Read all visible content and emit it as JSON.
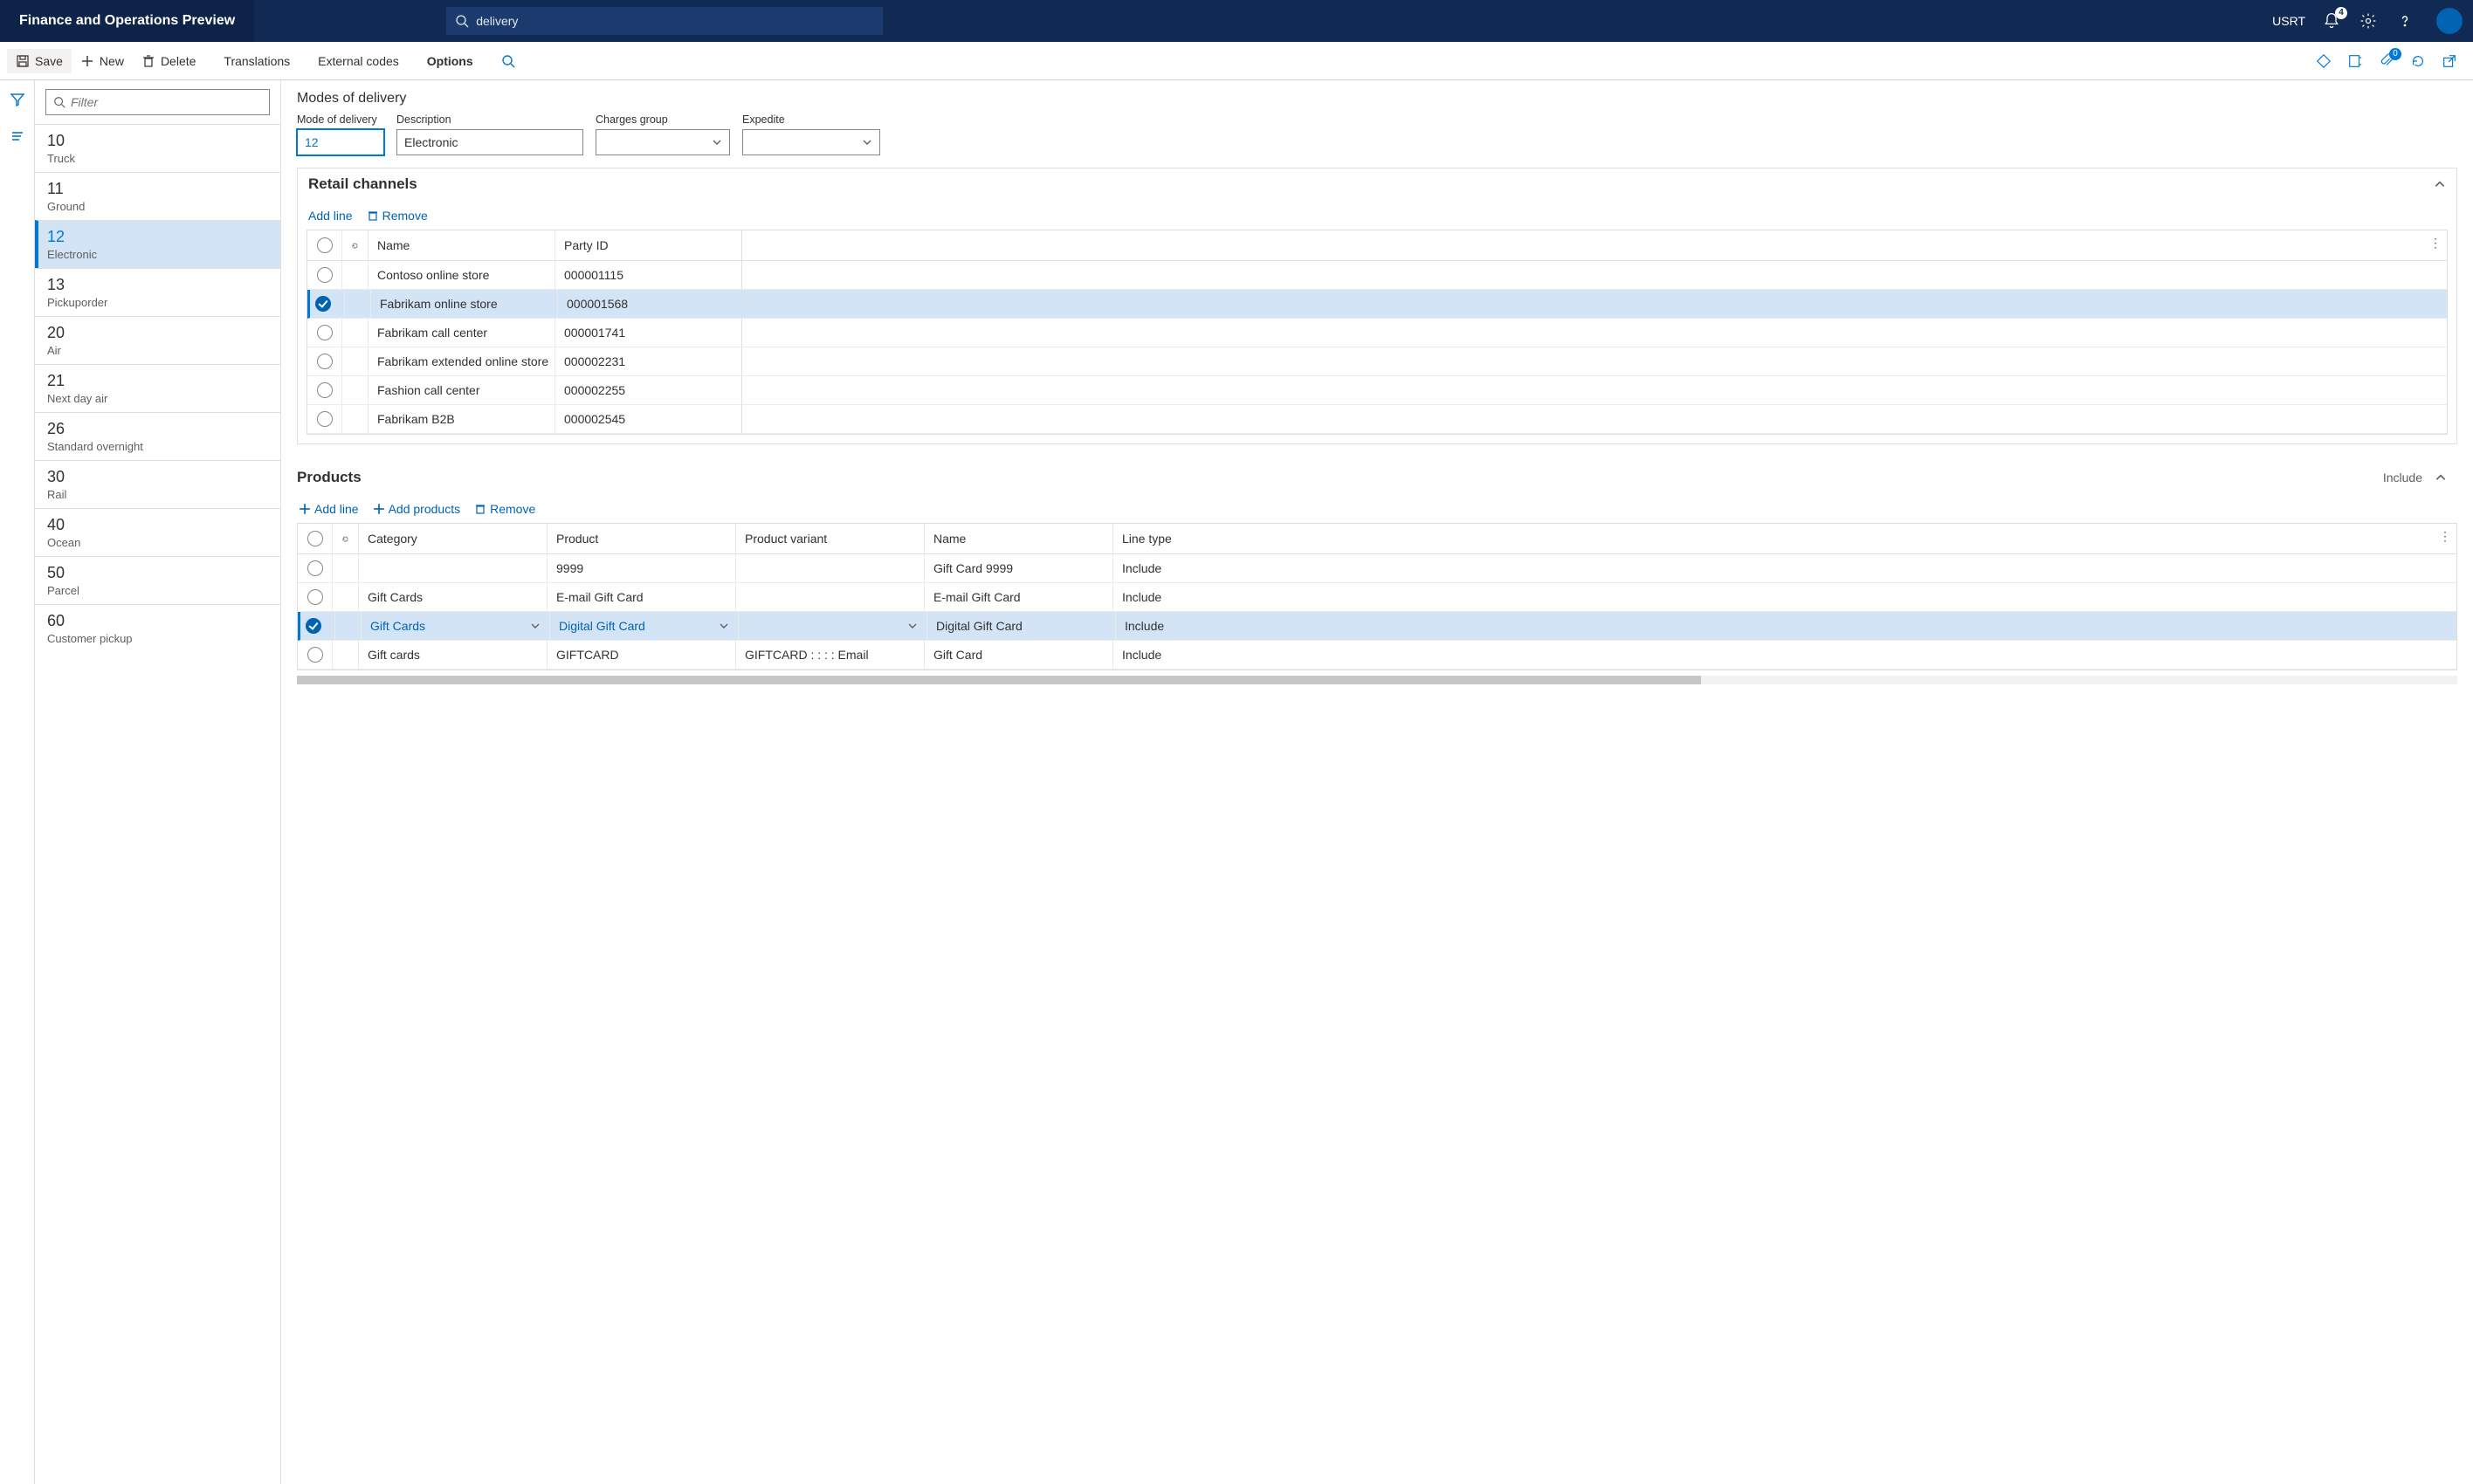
{
  "topbar": {
    "brand": "Finance and Operations Preview",
    "search_query": "delivery",
    "legal_entity": "USRT",
    "notification_count": "4"
  },
  "actionbar": {
    "save": "Save",
    "new": "New",
    "delete": "Delete",
    "translations": "Translations",
    "external_codes": "External codes",
    "options": "Options",
    "attach_count": "0"
  },
  "sidebar": {
    "filter_placeholder": "Filter",
    "items": [
      {
        "code": "10",
        "desc": "Truck"
      },
      {
        "code": "11",
        "desc": "Ground"
      },
      {
        "code": "12",
        "desc": "Electronic"
      },
      {
        "code": "13",
        "desc": "Pickuporder"
      },
      {
        "code": "20",
        "desc": "Air"
      },
      {
        "code": "21",
        "desc": "Next day air"
      },
      {
        "code": "26",
        "desc": "Standard overnight"
      },
      {
        "code": "30",
        "desc": "Rail"
      },
      {
        "code": "40",
        "desc": "Ocean"
      },
      {
        "code": "50",
        "desc": "Parcel"
      },
      {
        "code": "60",
        "desc": "Customer pickup"
      }
    ],
    "selected_index": 2
  },
  "page": {
    "title": "Modes of delivery",
    "fields": {
      "mode_of_delivery": {
        "label": "Mode of delivery",
        "value": "12"
      },
      "description": {
        "label": "Description",
        "value": "Electronic"
      },
      "charges_group": {
        "label": "Charges group",
        "value": ""
      },
      "expedite": {
        "label": "Expedite",
        "value": ""
      }
    }
  },
  "retail_channels": {
    "title": "Retail channels",
    "toolbar": {
      "add_line": "Add line",
      "remove": "Remove"
    },
    "columns": {
      "name": "Name",
      "party_id": "Party ID"
    },
    "rows": [
      {
        "name": "Contoso online store",
        "party_id": "000001115"
      },
      {
        "name": "Fabrikam online store",
        "party_id": "000001568"
      },
      {
        "name": "Fabrikam call center",
        "party_id": "000001741"
      },
      {
        "name": "Fabrikam extended online store",
        "party_id": "000002231"
      },
      {
        "name": "Fashion call center",
        "party_id": "000002255"
      },
      {
        "name": "Fabrikam B2B",
        "party_id": "000002545"
      }
    ],
    "selected_index": 1
  },
  "products": {
    "title": "Products",
    "header_flag": "Include",
    "toolbar": {
      "add_line": "Add line",
      "add_products": "Add products",
      "remove": "Remove"
    },
    "columns": {
      "category": "Category",
      "product": "Product",
      "variant": "Product variant",
      "name": "Name",
      "line_type": "Line type"
    },
    "rows": [
      {
        "category": "",
        "product": "9999",
        "variant": "",
        "name": "Gift Card 9999",
        "line_type": "Include"
      },
      {
        "category": "Gift Cards",
        "product": "E-mail Gift Card",
        "variant": "",
        "name": "E-mail Gift Card",
        "line_type": "Include"
      },
      {
        "category": "Gift Cards",
        "product": "Digital Gift Card",
        "variant": "",
        "name": "Digital Gift Card",
        "line_type": "Include"
      },
      {
        "category": "Gift cards",
        "product": "GIFTCARD",
        "variant": "GIFTCARD :  :  :  : Email",
        "name": "Gift Card",
        "line_type": "Include"
      }
    ],
    "selected_index": 2
  }
}
